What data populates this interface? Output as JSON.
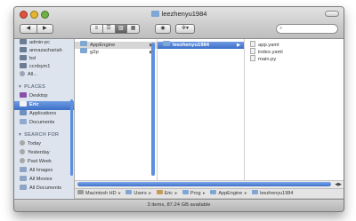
{
  "window": {
    "title": "leezhenyu1984"
  },
  "toolbar": {
    "back_glyph": "◀",
    "forward_glyph": "▶",
    "view_icons": [
      "≡",
      "☰",
      "▥",
      "▦"
    ],
    "eye_glyph": "◉",
    "gear_glyph": "✲▾",
    "search_glyph": "⌕",
    "search_placeholder": ""
  },
  "sidebar": {
    "devices_partial": [
      "admin-pc",
      "annazachariah",
      "bsl",
      "ccnlsym1",
      "All..."
    ],
    "places_header": "PLACES",
    "places": [
      "Desktop",
      "Eric",
      "Applications",
      "Documents"
    ],
    "search_header": "SEARCH FOR",
    "searches": [
      "Today",
      "Yesterday",
      "Past Week",
      "All Images",
      "All Movies",
      "All Documents"
    ]
  },
  "columns": {
    "col1": [
      "AppEngine",
      "g2p"
    ],
    "col2": [
      "leezhenyu1984"
    ],
    "col3": [
      "app.yaml",
      "index.yaml",
      "main.py"
    ]
  },
  "pathbar": [
    "Macintosh HD",
    "Users",
    "Eric",
    "Prog",
    "AppEngine",
    "leezhenyu1984"
  ],
  "status": "3 items, 87.24 GB available",
  "colors": {
    "selection": "#3d6fc7",
    "sidebar_bg": "#dde4ee",
    "folder": "#7fa7d4"
  }
}
